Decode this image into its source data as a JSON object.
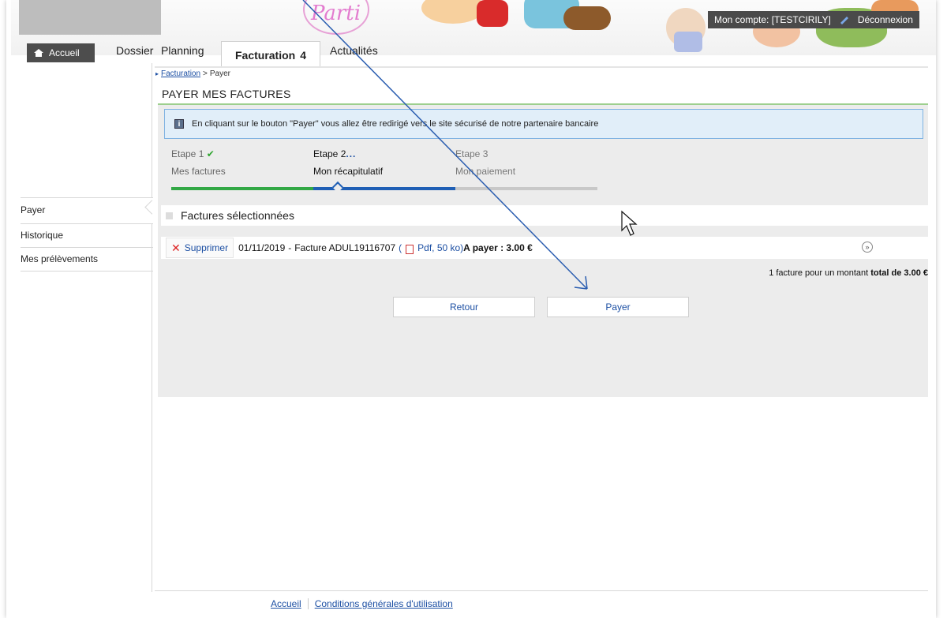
{
  "header": {
    "account_label": "Mon compte: [TESTCIRILY]",
    "logout_label": "Déconnexion",
    "banner_logo_text": "Parti"
  },
  "nav": {
    "home": "Accueil",
    "tabs": [
      "Dossier",
      "Planning",
      "Facturation",
      "Actualités"
    ],
    "active_tab": "Facturation",
    "active_badge": "4"
  },
  "breadcrumb": {
    "parent": "Facturation",
    "separator": ">",
    "current": "Payer"
  },
  "page_title": "PAYER MES FACTURES",
  "info_message": "En cliquant sur le bouton \"Payer\" vous allez être redirigé vers le site sécurisé de notre partenaire bancaire",
  "steps": [
    {
      "label": "Etape 1",
      "name": "Mes factures",
      "status": "done"
    },
    {
      "label": "Etape 2",
      "name": "Mon récapitulatif",
      "status": "current"
    },
    {
      "label": "Etape 3",
      "name": "Mon paiement",
      "status": "pending"
    }
  ],
  "sidebar": {
    "items": [
      {
        "label": "Payer",
        "active": true
      },
      {
        "label": "Historique"
      },
      {
        "label": "Mes prélèvements"
      }
    ]
  },
  "selected": {
    "header": "Factures sélectionnées",
    "rows": [
      {
        "delete_label": "Supprimer",
        "date": "01/11/2019",
        "invoice": "Facture ADUL19116707",
        "pdf_label": "Pdf, 50 ko)",
        "amount_label": "A payer : 3.00 €"
      }
    ],
    "total_prefix": "1 facture pour un montant",
    "total_bold": "total de 3.00 €"
  },
  "buttons": {
    "back": "Retour",
    "pay": "Payer"
  },
  "footer": {
    "home": "Accueil",
    "terms": "Conditions générales d'utilisation"
  },
  "colors": {
    "accent_blue": "#1c4fa3",
    "step_green": "#32a845",
    "step_blue": "#1f5fb5",
    "info_bg": "#e1eef9"
  }
}
